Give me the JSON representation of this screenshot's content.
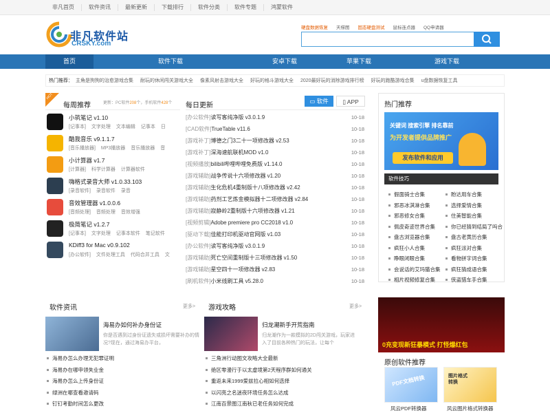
{
  "topnav": [
    "非凡首页",
    "软件资讯",
    "最新更新",
    "下载排行",
    "软件分类",
    "软件专题",
    "鸿蒙软件"
  ],
  "logo": {
    "cn": "非凡软件站",
    "en": "CRSKY.com"
  },
  "hot_keywords": [
    {
      "text": "硬盘数据恢复",
      "highlight": true
    },
    {
      "text": "天梯图",
      "highlight": false
    },
    {
      "text": "固态硬盘测试",
      "highlight": true
    },
    {
      "text": "鼠标连点器",
      "highlight": false
    },
    {
      "text": "QQ申请器",
      "highlight": false
    }
  ],
  "search": {
    "value": ""
  },
  "mainnav": [
    "首页",
    "软件下载",
    "安卓下载",
    "苹果下载",
    "游戏下载"
  ],
  "hotline": {
    "label": "热门推荐：",
    "items": [
      "主角是狗狗的治愈游戏合集",
      "耐玩的休闲闯关游戏大全",
      "像素风射击游戏大全",
      "好玩的格斗游戏大全",
      "2020最好玩的消除游戏排行榜",
      "好玩的跑酷游戏合集",
      "u盘数据恢复工具"
    ]
  },
  "weekly": {
    "badge": "HOT",
    "title": "每周推荐",
    "note_prefix": "更新：PC软件",
    "pc_count": "208",
    "note_mid": "个，手机软件",
    "mobile_count": "428",
    "note_suffix": "个",
    "apps": [
      {
        "name": "小筑笔记 v1.10",
        "tags": [
          "[记事本]",
          "文字处理",
          "文本编辑",
          "记事本",
          "日"
        ],
        "color": "#111"
      },
      {
        "name": "酷我音乐 v9.1.1.7",
        "tags": [
          "[音乐播放器]",
          "MP3播放器",
          "音乐播放器",
          "音"
        ],
        "color": "#f5b400"
      },
      {
        "name": "小计算器 v1.7",
        "tags": [
          "[计算器]",
          "科学计算器",
          "计算器软件"
        ],
        "color": "#f39c12"
      },
      {
        "name": "嗨格式录音大师 v1.0.33.103",
        "tags": [
          "[录音软件]",
          "录音软件",
          "录音"
        ],
        "color": "#2c3e50"
      },
      {
        "name": "音效管理器 v1.0.0.6",
        "tags": [
          "[音频处理]",
          "音频处理",
          "音效增强"
        ],
        "color": "#e74c3c"
      },
      {
        "name": "极简笔记 v1.2.7",
        "tags": [
          "[记事本]",
          "文字处理",
          "记事本软件",
          "笔记软件"
        ],
        "color": "#222"
      },
      {
        "name": "KDiff3 for Mac v0.9.102",
        "tags": [
          "[办公软件]",
          "文件处理工具",
          "代码合并工具",
          "文"
        ],
        "color": "#34495e"
      }
    ]
  },
  "daily": {
    "title": "每日更新",
    "tab_soft": "软件",
    "tab_app": "APP",
    "rows": [
      {
        "cat": "[办公软件]",
        "title": "读写客纯净版 v3.0.1.9",
        "date": "10-18"
      },
      {
        "cat": "[CAD软件]",
        "title": "TrueTable v11.6",
        "date": "10-18"
      },
      {
        "cat": "[游戏补丁]",
        "title": "博德之门3二十一项修改器 v2.53",
        "date": "10-18"
      },
      {
        "cat": "[游戏补丁]",
        "title": "深海速航联机MOD v1.0",
        "date": "10-18"
      },
      {
        "cat": "[视频播放]",
        "title": "bilibili哔哩哔哩免费版 v1.14.0",
        "date": "10-18"
      },
      {
        "cat": "[游戏辅助]",
        "title": "战争传说十六项修改器 v1.20",
        "date": "10-18"
      },
      {
        "cat": "[游戏辅助]",
        "title": "生化危机4重制版十八项修改器 v2.42",
        "date": "10-18"
      },
      {
        "cat": "[游戏辅助]",
        "title": "药剂工艺炼金模拟器十二项修改器 v2.84",
        "date": "10-18"
      },
      {
        "cat": "[游戏辅助]",
        "title": "寂静岭2重制版十六项修改器 v1.21",
        "date": "10-18"
      },
      {
        "cat": "[视频剪辑]",
        "title": "Adobe premiere pro CC2018 v1.0",
        "date": "10-18"
      },
      {
        "cat": "[驱动下载]",
        "title": "佳能打印机驱动官网版 v1.03",
        "date": "10-18"
      },
      {
        "cat": "[办公软件]",
        "title": "读写客纯净版 v3.0.1.9",
        "date": "10-18"
      },
      {
        "cat": "[游戏辅助]",
        "title": "死亡空间重制版十三项修改器 v1.50",
        "date": "10-18"
      },
      {
        "cat": "[游戏辅助]",
        "title": "星空四十一项修改器 v2.83",
        "date": "10-18"
      },
      {
        "cat": "[刷机软件]",
        "title": "小米线刷工具 v5.28.0",
        "date": "10-18"
      }
    ]
  },
  "hotrec": {
    "title": "热门推荐",
    "banner_line1": "关键词  搜索引擎  排名靠前",
    "banner_line2": "为开发者提供品牌推广",
    "banner_btn": "发布软件和应用",
    "tip_title": "软件技巧",
    "tips": [
      [
        "假面骑士合集",
        "盼达用车合集"
      ],
      [
        "邪恶冰淇淋合集",
        "选择爱情合集"
      ],
      [
        "邪恶修女合集",
        "住美智能合集"
      ],
      [
        "佩皮奇迹世界合集",
        "你已经猜到结局了吗合"
      ],
      [
        "盘古浏览器合集",
        "盘古老黄历合集"
      ],
      [
        "疯狂小人合集",
        "疯狂派对合集"
      ],
      [
        "睁眼闭眼合集",
        "看物拼字词合集"
      ],
      [
        "会说话的艾玛猫合集",
        "疯狂猜成语合集"
      ],
      [
        "相片视频修复合集",
        "侠盗猎车手合集"
      ]
    ]
  },
  "softnews": {
    "title": "软件资讯",
    "more": "更多>",
    "top_title": "海易办如何补办身份证",
    "top_desc": "你是否遇到过身份证遗失或损坏需要补办的情况?现在，通过海易办平台，",
    "items": [
      "海易办怎么办理无犯罪证明",
      "海易办在哪申领失业金",
      "海易办怎么上传身份证",
      "绿洲在哪查看邀请码",
      "钉钉考勤时间怎么更改"
    ]
  },
  "gamenews": {
    "title": "游戏攻略",
    "more": "更多>",
    "top_title": "归龙潮新手开荒指南",
    "top_desc": "归龙潮作为一款模拟的2D闯关游戏，玩家进入了目前各种热门的玩法，让每个",
    "items": [
      "三角洲行动图文攻略大全最新",
      "绝区零漫行于以太虚境第2天程序群如何通关",
      "重返未来1999爱兹拉心相如何选择",
      "以闪亮之名迷夜环境任务怎么达成",
      "江南百景图江南秋已老任务如何完成"
    ]
  },
  "promo": {
    "text": "0充变现新狂暴模式 打怪爆红包"
  },
  "original": {
    "title": "原创软件推荐",
    "items": [
      {
        "caption": "风云PDF转换器",
        "thumb_text": "PDF文档转换"
      },
      {
        "caption": "风云图片格式转换器",
        "thumb_text": "图片格式转换"
      }
    ]
  },
  "colors": {
    "nav": "#2a75b6",
    "accent": "#2f8fe0",
    "hot": "#f28e1e"
  }
}
